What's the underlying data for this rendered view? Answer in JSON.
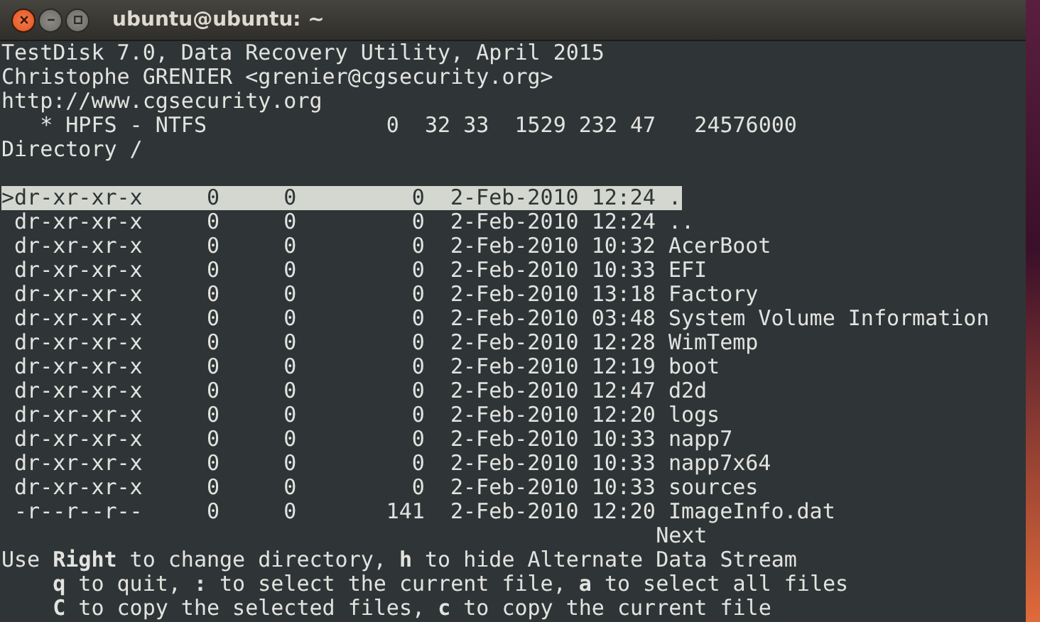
{
  "window": {
    "title": "ubuntu@ubuntu: ~"
  },
  "header_lines": [
    "TestDisk 7.0, Data Recovery Utility, April 2015",
    "Christophe GRENIER <grenier@cgsecurity.org>",
    "http://www.cgsecurity.org",
    "   * HPFS - NTFS              0  32 33  1529 232 47   24576000",
    "Directory /"
  ],
  "table": {
    "rows": [
      {
        "pointer": ">",
        "selected": true,
        "permissions": "dr-xr-xr-x",
        "uid": "0",
        "gid": "0",
        "size": "0",
        "date": "2-Feb-2010",
        "time": "12:24",
        "name": "."
      },
      {
        "selected": false,
        "permissions": "dr-xr-xr-x",
        "uid": "0",
        "gid": "0",
        "size": "0",
        "date": "2-Feb-2010",
        "time": "12:24",
        "name": ".."
      },
      {
        "selected": false,
        "permissions": "dr-xr-xr-x",
        "uid": "0",
        "gid": "0",
        "size": "0",
        "date": "2-Feb-2010",
        "time": "10:32",
        "name": "AcerBoot"
      },
      {
        "selected": false,
        "permissions": "dr-xr-xr-x",
        "uid": "0",
        "gid": "0",
        "size": "0",
        "date": "2-Feb-2010",
        "time": "10:33",
        "name": "EFI"
      },
      {
        "selected": false,
        "permissions": "dr-xr-xr-x",
        "uid": "0",
        "gid": "0",
        "size": "0",
        "date": "2-Feb-2010",
        "time": "13:18",
        "name": "Factory"
      },
      {
        "selected": false,
        "permissions": "dr-xr-xr-x",
        "uid": "0",
        "gid": "0",
        "size": "0",
        "date": "2-Feb-2010",
        "time": "03:48",
        "name": "System Volume Information"
      },
      {
        "selected": false,
        "permissions": "dr-xr-xr-x",
        "uid": "0",
        "gid": "0",
        "size": "0",
        "date": "2-Feb-2010",
        "time": "12:28",
        "name": "WimTemp"
      },
      {
        "selected": false,
        "permissions": "dr-xr-xr-x",
        "uid": "0",
        "gid": "0",
        "size": "0",
        "date": "2-Feb-2010",
        "time": "12:19",
        "name": "boot"
      },
      {
        "selected": false,
        "permissions": "dr-xr-xr-x",
        "uid": "0",
        "gid": "0",
        "size": "0",
        "date": "2-Feb-2010",
        "time": "12:47",
        "name": "d2d"
      },
      {
        "selected": false,
        "permissions": "dr-xr-xr-x",
        "uid": "0",
        "gid": "0",
        "size": "0",
        "date": "2-Feb-2010",
        "time": "12:20",
        "name": "logs"
      },
      {
        "selected": false,
        "permissions": "dr-xr-xr-x",
        "uid": "0",
        "gid": "0",
        "size": "0",
        "date": "2-Feb-2010",
        "time": "10:33",
        "name": "napp7"
      },
      {
        "selected": false,
        "permissions": "dr-xr-xr-x",
        "uid": "0",
        "gid": "0",
        "size": "0",
        "date": "2-Feb-2010",
        "time": "10:33",
        "name": "napp7x64"
      },
      {
        "selected": false,
        "permissions": "dr-xr-xr-x",
        "uid": "0",
        "gid": "0",
        "size": "0",
        "date": "2-Feb-2010",
        "time": "10:33",
        "name": "sources"
      },
      {
        "selected": false,
        "permissions": "-r--r--r--",
        "uid": "0",
        "gid": "0",
        "size": "141",
        "date": "2-Feb-2010",
        "time": "12:20",
        "name": "ImageInfo.dat"
      }
    ]
  },
  "next_label": "Next",
  "help_lines": [
    "Use **Right** to change directory, **h** to hide Alternate Data Stream",
    "    **q** to quit, **:** to select the current file, **a** to select all files",
    "    **C** to copy the selected files, **c** to copy the current file"
  ]
}
